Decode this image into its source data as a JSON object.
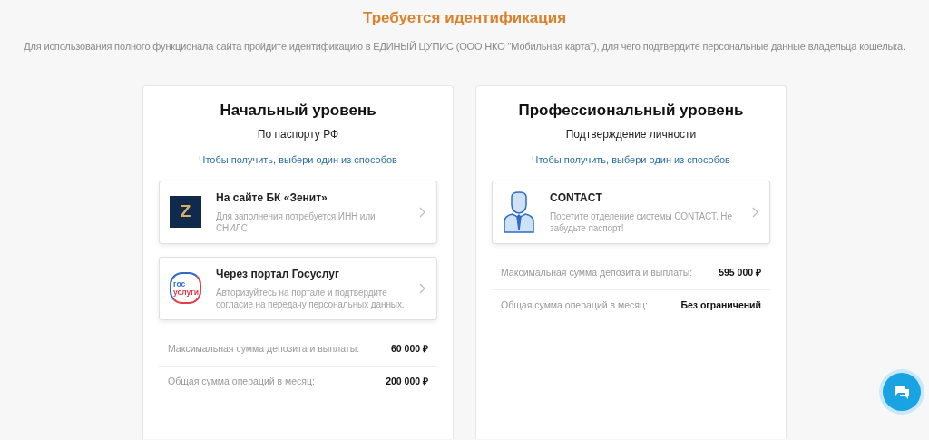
{
  "header": {
    "title": "Требуется идентификация",
    "description": "Для использования полного функционала сайта пройдите идентификацию в ЕДИНЫЙ ЦУПИС (ООО НКО \"Мобильная карта\"), для чего подтвердите персональные данные владельца кошелька."
  },
  "levels": [
    {
      "title": "Начальный уровень",
      "subtitle": "По паспорту РФ",
      "hint": "Чтобы получить, выбери один из способов",
      "methods": [
        {
          "kind": "zenit",
          "logo_text": [
            "Z"
          ],
          "title": "На сайте БК «Зенит»",
          "description": "Для заполнения потребуется ИНН или СНИЛС."
        },
        {
          "kind": "gosuslugi",
          "logo_text": [
            "гос",
            "услуги"
          ],
          "title": "Через портал Госуслуг",
          "description": "Авторизуйтесь на портале и подтвердите согласие на передачу персональных данных."
        }
      ],
      "limits": [
        {
          "label": "Максимальная сумма депозита и выплаты:",
          "value": "60 000 ₽"
        },
        {
          "label": "Общая сумма операций в месяц:",
          "value": "200 000 ₽"
        }
      ]
    },
    {
      "title": "Профессиональный уровень",
      "subtitle": "Подтверждение личности",
      "hint": "Чтобы получить, выбери один из способов",
      "methods": [
        {
          "kind": "person",
          "title": "CONTACT",
          "description": "Посетите отделение системы CONTACT. Не забудьте паспорт!"
        }
      ],
      "limits": [
        {
          "label": "Максимальная сумма депозита и выплаты:",
          "value": "595 000 ₽"
        },
        {
          "label": "Общая сумма операций в месяц:",
          "value": "Без ограничений"
        }
      ]
    }
  ]
}
